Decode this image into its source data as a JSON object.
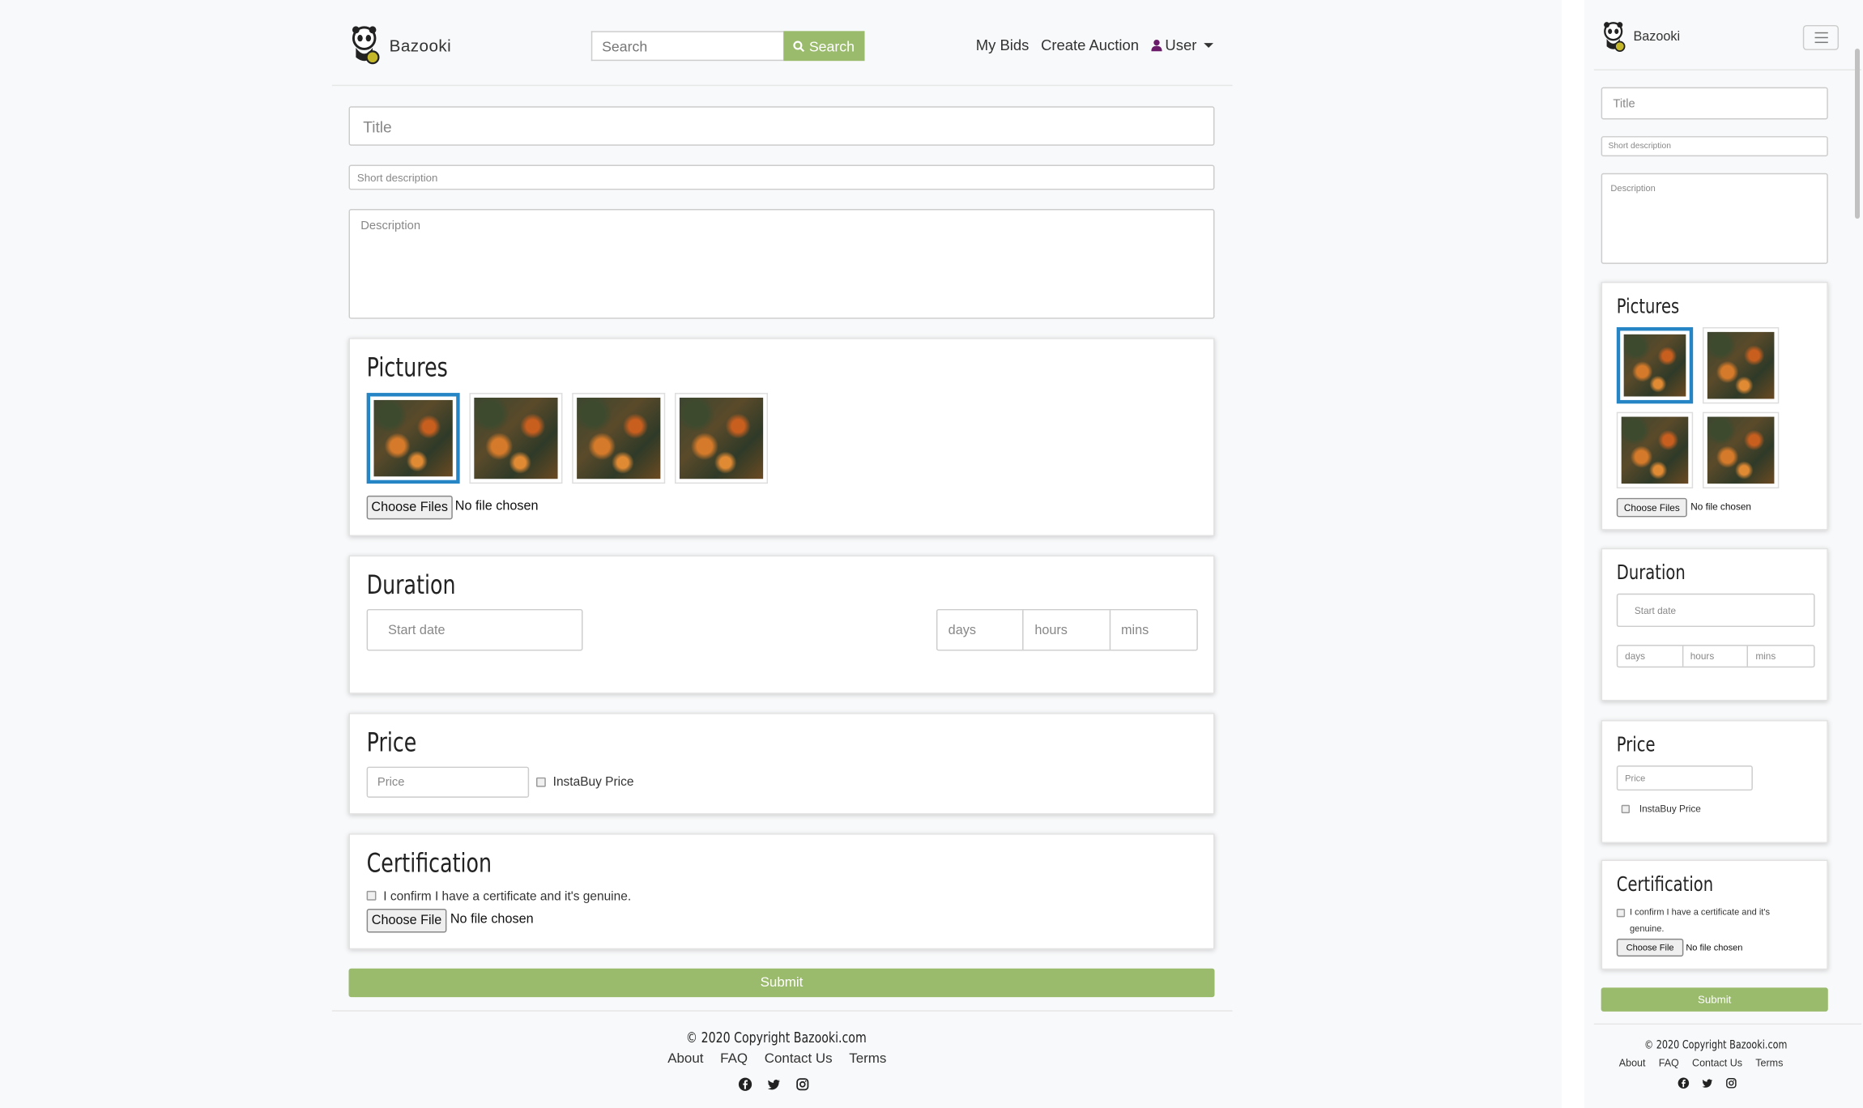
{
  "brand": {
    "name": "Bazooki"
  },
  "header": {
    "search_placeholder": "Search",
    "search_button": "Search",
    "nav": {
      "my_bids": "My Bids",
      "create_auction": "Create Auction",
      "user": "User"
    }
  },
  "form": {
    "title_placeholder": "Title",
    "short_description_placeholder": "Short description",
    "description_placeholder": "Description",
    "pictures": {
      "heading": "Pictures",
      "thumbnail_count": 4,
      "selected_index": 0,
      "choose_files": "Choose Files",
      "no_file": "No file chosen"
    },
    "duration": {
      "heading": "Duration",
      "start_date_placeholder": "Start date",
      "days_placeholder": "days",
      "hours_placeholder": "hours",
      "mins_placeholder": "mins"
    },
    "price": {
      "heading": "Price",
      "price_placeholder": "Price",
      "instabuy_label": "InstaBuy Price"
    },
    "certification": {
      "heading": "Certification",
      "confirm_label": "I confirm I have a certificate and it's genuine.",
      "mobile_confirm_line1": "I confirm I have a certificate and it's",
      "mobile_confirm_line2": "genuine.",
      "choose_file": "Choose File",
      "no_file": "No file chosen"
    },
    "submit": "Submit"
  },
  "footer": {
    "copyright": "© 2020 Copyright Bazooki.com",
    "links": {
      "about": "About",
      "faq": "FAQ",
      "contact": "Contact Us",
      "terms": "Terms"
    }
  },
  "colors": {
    "accent": "#9aba6c",
    "selected_border": "#2686c5",
    "user_icon": "#6a1b6a"
  }
}
